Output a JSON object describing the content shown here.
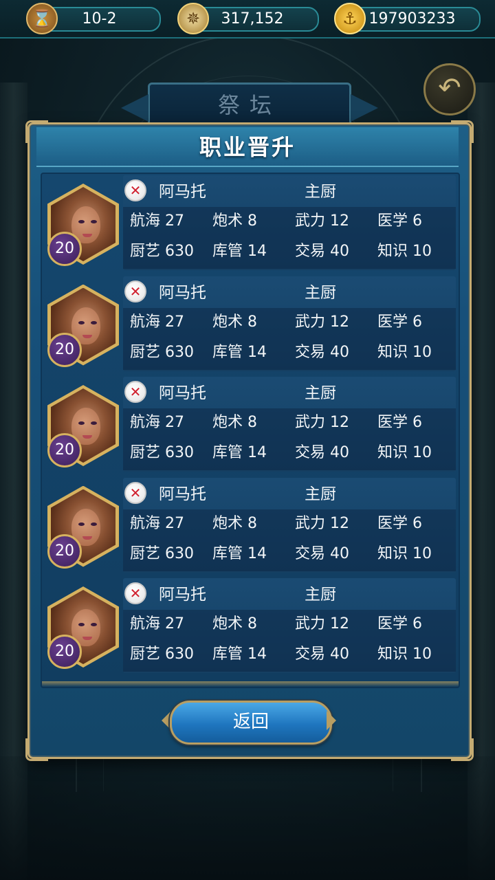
{
  "topbar": {
    "stage": "10-2",
    "compass_value": "317,152",
    "gold_value": "197903233"
  },
  "icons": {
    "stage": "hourglass-icon",
    "compass": "compass-icon",
    "gold": "anchor-coin-icon",
    "back": "back-arrow-icon",
    "class": "cross-emblem-icon"
  },
  "altar_title": "祭坛",
  "panel": {
    "title": "职业晋升",
    "return_label": "返回"
  },
  "captains": [
    {
      "level": "20",
      "name": "阿马托",
      "job": "主厨",
      "stats": [
        "航海 27",
        "炮术 8",
        "武力 12",
        "医学 6",
        "厨艺 630",
        "库管 14",
        "交易 40",
        "知识 10"
      ]
    },
    {
      "level": "20",
      "name": "阿马托",
      "job": "主厨",
      "stats": [
        "航海 27",
        "炮术 8",
        "武力 12",
        "医学 6",
        "厨艺 630",
        "库管 14",
        "交易 40",
        "知识 10"
      ]
    },
    {
      "level": "20",
      "name": "阿马托",
      "job": "主厨",
      "stats": [
        "航海 27",
        "炮术 8",
        "武力 12",
        "医学 6",
        "厨艺 630",
        "库管 14",
        "交易 40",
        "知识 10"
      ]
    },
    {
      "level": "20",
      "name": "阿马托",
      "job": "主厨",
      "stats": [
        "航海 27",
        "炮术 8",
        "武力 12",
        "医学 6",
        "厨艺 630",
        "库管 14",
        "交易 40",
        "知识 10"
      ]
    },
    {
      "level": "20",
      "name": "阿马托",
      "job": "主厨",
      "stats": [
        "航海 27",
        "炮术 8",
        "武力 12",
        "医学 6",
        "厨艺 630",
        "库管 14",
        "交易 40",
        "知识 10"
      ]
    }
  ],
  "colors": {
    "panel_border": "#c4ab72",
    "panel_bg": "#17507a",
    "button_blue": "#1f76bf",
    "level_badge": "#3a1f5a"
  }
}
